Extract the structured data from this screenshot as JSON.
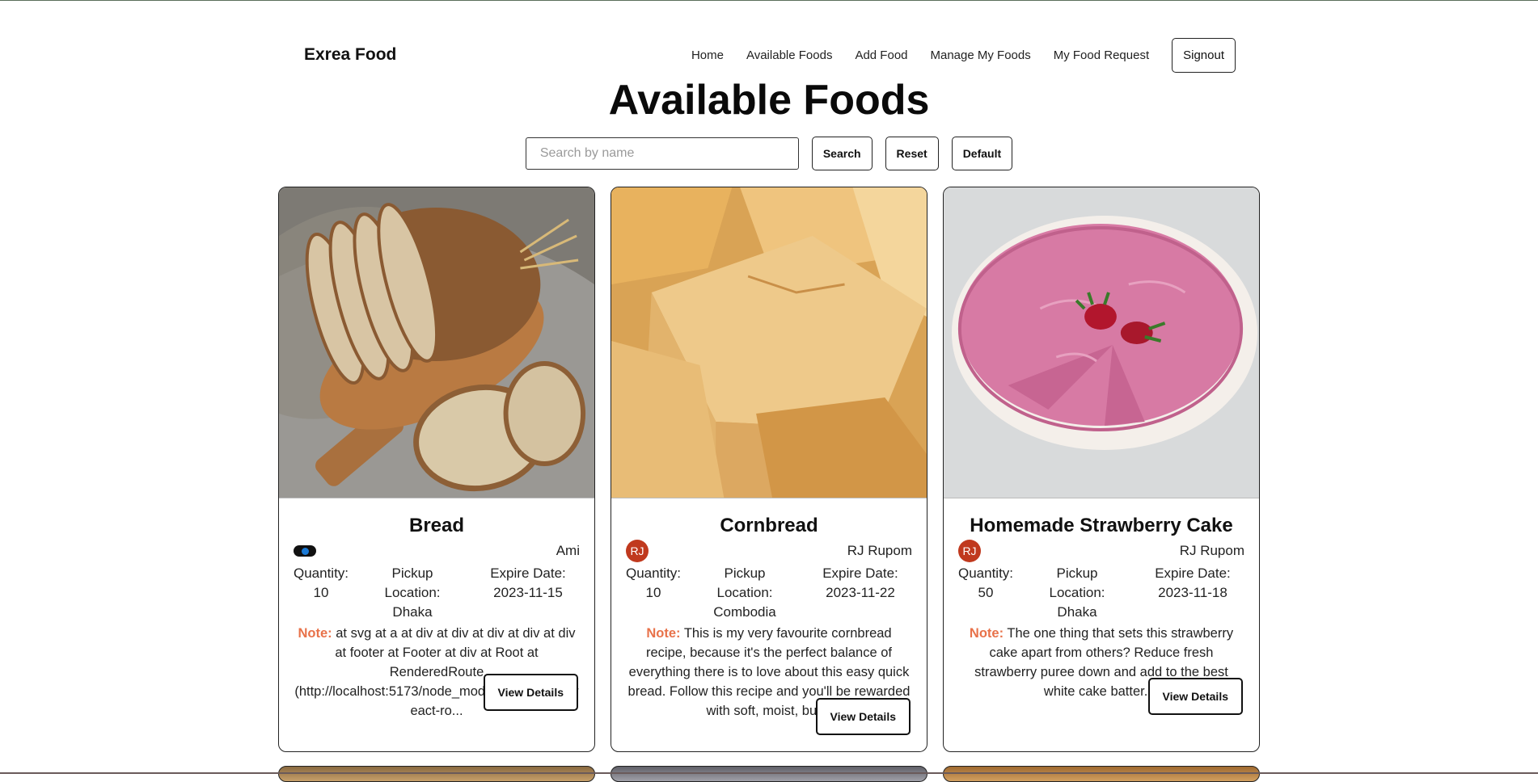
{
  "nav": {
    "brand": "Exrea Food",
    "links": [
      "Home",
      "Available Foods",
      "Add Food",
      "Manage My Foods",
      "My Food Request"
    ],
    "signout": "Signout"
  },
  "page": {
    "title": "Available Foods"
  },
  "search": {
    "placeholder": "Search by name",
    "value": "",
    "search_label": "Search",
    "reset_label": "Reset",
    "default_label": "Default"
  },
  "labels": {
    "note": "Note:",
    "view_details": "View Details"
  },
  "foods": [
    {
      "name": "Bread",
      "avatar": "",
      "donor": "Ami",
      "quantity": "Quantity: 10",
      "location": "Pickup Location: Dhaka",
      "expire": "Expire Date: 2023-11-15",
      "note": "at svg at a at div at div at div at div at div at footer at Footer at div at Root at RenderedRoute (http://localhost:5173/node_modules/.vite/deps/react-ro..."
    },
    {
      "name": "Cornbread",
      "avatar": "RJ",
      "donor": "RJ Rupom",
      "quantity": "Quantity: 10",
      "location": "Pickup Location: Combodia",
      "expire": "Expire Date: 2023-11-22",
      "note": "This is my very favourite cornbread recipe, because it's the perfect balance of everything there is to love about this easy quick bread. Follow this recipe and you'll be rewarded with soft, moist, but..."
    },
    {
      "name": "Homemade Strawberry Cake",
      "avatar": "RJ",
      "donor": "RJ Rupom",
      "quantity": "Quantity: 50",
      "location": "Pickup Location: Dhaka",
      "expire": "Expire Date: 2023-11-18",
      "note": "The one thing that sets this strawberry cake apart from others? Reduce fresh strawberry puree down and add to the best white cake batter...."
    }
  ]
}
